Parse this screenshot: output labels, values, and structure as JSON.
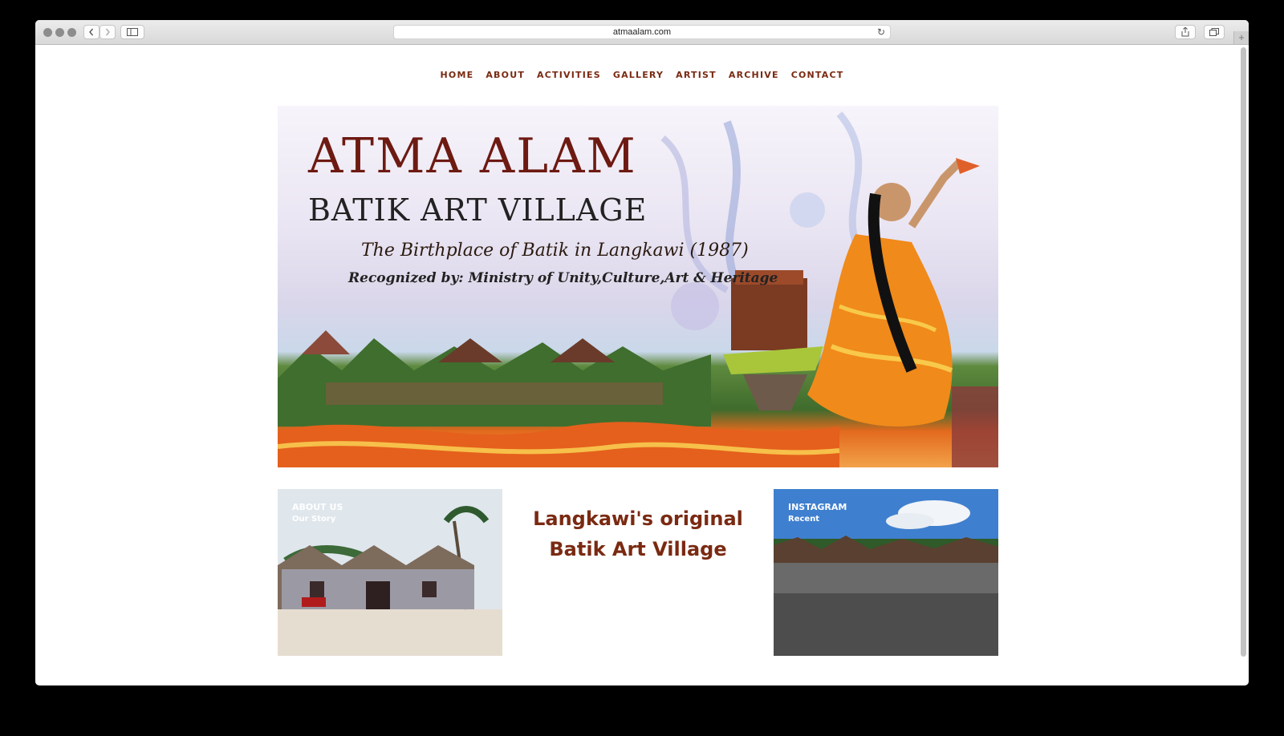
{
  "browser": {
    "url": "atmaalam.com"
  },
  "nav": [
    "HOME",
    "ABOUT",
    "ACTIVITIES",
    "GALLERY",
    "ARTIST",
    "ARCHIVE",
    "CONTACT"
  ],
  "hero": {
    "title": "ATMA ALAM",
    "subtitle": "BATIK ART VILLAGE",
    "tagline": "The Birthplace of Batik in Langkawi (1987)",
    "recognition": "Recognized by: Ministry of Unity,Culture,Art & Heritage"
  },
  "cards": {
    "about": {
      "label": "ABOUT US",
      "sub": "Our Story"
    },
    "headline_line1": "Langkawi's original",
    "headline_line2": "Batik Art Village",
    "instagram": {
      "label": "INSTAGRAM",
      "sub": "Recent"
    }
  },
  "colors": {
    "brand": "#7a2a12",
    "title_red": "#6d1a12"
  }
}
